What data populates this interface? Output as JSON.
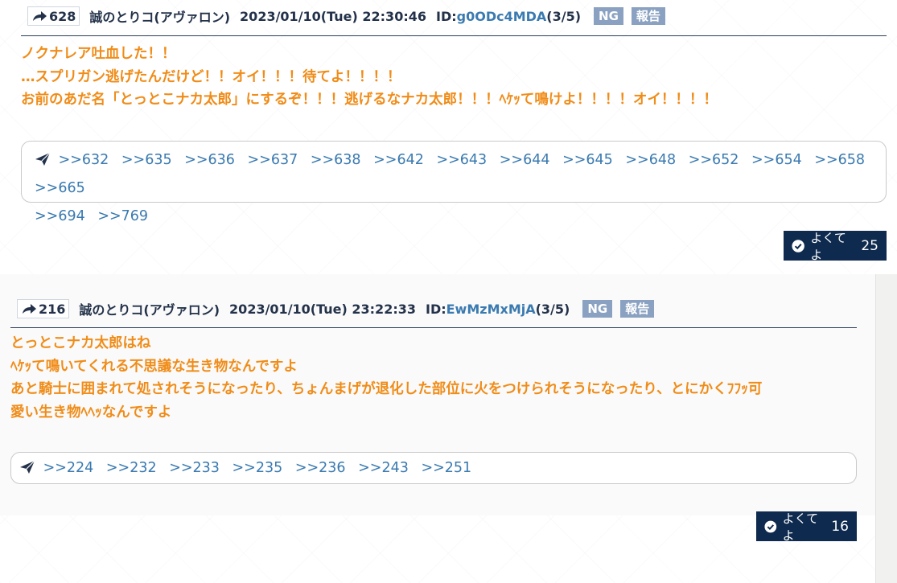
{
  "posts": [
    {
      "number": "628",
      "author": "誠のとりコ(アヴァロン)",
      "datetime": "2023/01/10(Tue) 22:30:46",
      "id_label": "ID:",
      "id_value": "g0ODc4MDA",
      "id_count": "(3/5)",
      "ng_label": "NG",
      "report_label": "報告",
      "body_lines": [
        "ノクナレア吐血した！！",
        "…スプリガン逃げたんだけど！！オイ！！！待てよ！！！！",
        "お前のあだ名「とっとこナカ太郎」にするぞ！！！逃げるなナカ太郎！！！ﾍｹｯて鳴けよ！！！！オイ！！！！"
      ],
      "replies": [
        ">>632",
        ">>635",
        ">>636",
        ">>637",
        ">>638",
        ">>642",
        ">>643",
        ">>644",
        ">>645",
        ">>648",
        ">>652",
        ">>654",
        ">>658",
        ">>665",
        ">>694",
        ">>769"
      ],
      "like_label": "よくてよ",
      "like_count": "25"
    },
    {
      "number": "216",
      "author": "誠のとりコ(アヴァロン)",
      "datetime": "2023/01/10(Tue) 23:22:33",
      "id_label": "ID:",
      "id_value": "EwMzMxMjA",
      "id_count": "(3/5)",
      "ng_label": "NG",
      "report_label": "報告",
      "body_lines": [
        "とっとこナカ太郎はね",
        "ﾍｹｯて鳴いてくれる不思議な生き物なんですよ",
        "あと騎士に囲まれて処されそうになったり、ちょんまげが退化した部位に火をつけられそうになったり、とにかくﾌﾌｯ可",
        "愛い生き物ﾍﾍｯなんですよ"
      ],
      "replies": [
        ">>224",
        ">>232",
        ">>233",
        ">>235",
        ">>236",
        ">>243",
        ">>251"
      ],
      "like_label": "よくてよ",
      "like_count": "16"
    }
  ],
  "colors": {
    "header_text": "#23324a",
    "id_link": "#3a7ab0",
    "body_text": "#f08c18",
    "tag_bg": "#8aa1c1",
    "like_bg": "#0e2a4e"
  },
  "icons": {
    "number": "share-arrow-icon",
    "replies": "paper-plane-icon",
    "like": "check-circle-icon"
  }
}
